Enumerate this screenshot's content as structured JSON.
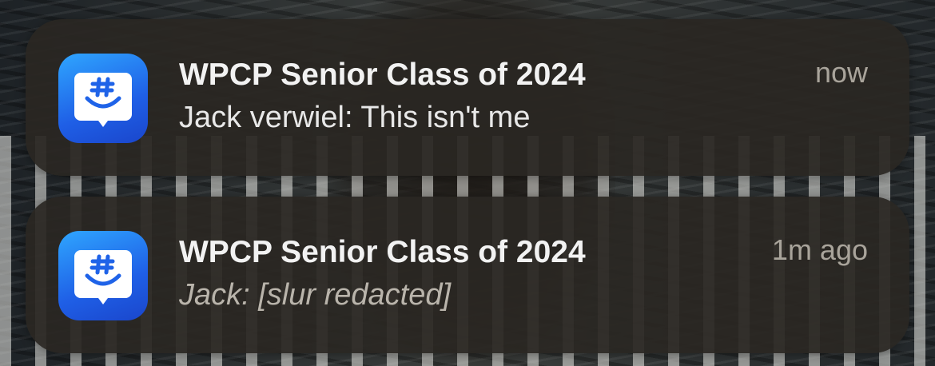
{
  "notifications": [
    {
      "app": "GroupMe",
      "app_icon": "groupme-app-icon",
      "title": "WPCP Senior Class of 2024",
      "message": "Jack verwiel: This isn't me",
      "time": "now"
    },
    {
      "app": "GroupMe",
      "app_icon": "groupme-app-icon",
      "title": "WPCP Senior Class of 2024",
      "message": "Jack: [slur redacted]",
      "time": "1m ago"
    }
  ],
  "colors": {
    "card_background": "#2a2722",
    "title_text": "#f2f2f2",
    "body_text": "#e8e8e8",
    "time_text": "#a9a49b",
    "icon_gradient_top": "#2fa6ff",
    "icon_gradient_bottom": "#1a46cc"
  }
}
